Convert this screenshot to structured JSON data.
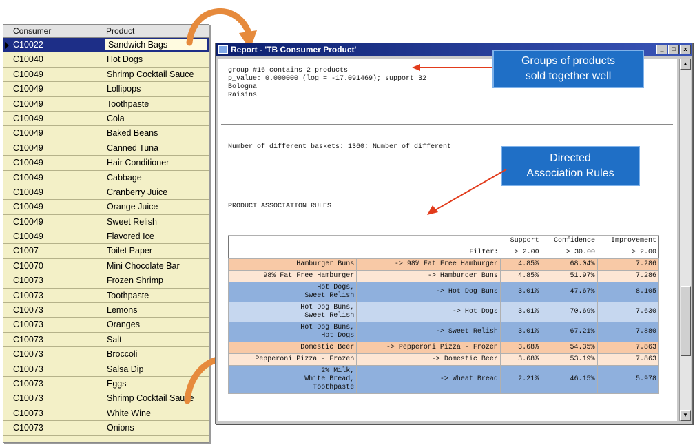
{
  "grid": {
    "columns": [
      "Consumer",
      "Product"
    ],
    "rows": [
      [
        "C10022",
        "Sandwich Bags"
      ],
      [
        "C10040",
        "Hot Dogs"
      ],
      [
        "C10049",
        "Shrimp Cocktail Sauce"
      ],
      [
        "C10049",
        "Lollipops"
      ],
      [
        "C10049",
        "Toothpaste"
      ],
      [
        "C10049",
        "Cola"
      ],
      [
        "C10049",
        "Baked Beans"
      ],
      [
        "C10049",
        "Canned Tuna"
      ],
      [
        "C10049",
        "Hair Conditioner"
      ],
      [
        "C10049",
        "Cabbage"
      ],
      [
        "C10049",
        "Cranberry Juice"
      ],
      [
        "C10049",
        "Orange Juice"
      ],
      [
        "C10049",
        "Sweet Relish"
      ],
      [
        "C10049",
        "Flavored Ice"
      ],
      [
        "C1007",
        "Toilet Paper"
      ],
      [
        "C10070",
        "Mini Chocolate Bar"
      ],
      [
        "C10073",
        "Frozen Shrimp"
      ],
      [
        "C10073",
        "Toothpaste"
      ],
      [
        "C10073",
        "Lemons"
      ],
      [
        "C10073",
        "Oranges"
      ],
      [
        "C10073",
        "Salt"
      ],
      [
        "C10073",
        "Broccoli"
      ],
      [
        "C10073",
        "Salsa Dip"
      ],
      [
        "C10073",
        "Eggs"
      ],
      [
        "C10073",
        "Shrimp Cocktail Sauce"
      ],
      [
        "C10073",
        "White Wine"
      ],
      [
        "C10073",
        "Onions"
      ]
    ],
    "selected_row": 0
  },
  "report": {
    "title": "Report - 'TB Consumer Product'",
    "window_buttons": [
      "_",
      "□",
      "x"
    ],
    "group_line1": "group #16 contains 2 products",
    "group_line2": "p_value: 0.000000 (log = -17.091469); support 32",
    "group_item1": "Bologna",
    "group_item2": "Raisins",
    "baskets_line": "Number of different baskets: 1360; Number of different",
    "rules_heading": "PRODUCT ASSOCIATION RULES",
    "table": {
      "headers": [
        "Support",
        "Confidence",
        "Improvement"
      ],
      "filter_label": "Filter:",
      "filters": [
        "> 2.00",
        "> 30.00",
        "> 2.00"
      ],
      "rows": [
        {
          "style": "peach",
          "lhs": "Hamburger Buns",
          "rhs": "-> 98% Fat Free Hamburger",
          "support": "4.85%",
          "confidence": "68.04%",
          "improvement": "7.286"
        },
        {
          "style": "lpeach",
          "lhs": "98% Fat Free Hamburger",
          "rhs": "-> Hamburger Buns",
          "support": "4.85%",
          "confidence": "51.97%",
          "improvement": "7.286"
        },
        {
          "style": "blue",
          "lhs": "Hot Dogs,\nSweet Relish",
          "rhs": "-> Hot Dog Buns",
          "support": "3.01%",
          "confidence": "47.67%",
          "improvement": "8.105"
        },
        {
          "style": "lblue",
          "lhs": "Hot Dog Buns,\nSweet Relish",
          "rhs": "-> Hot Dogs",
          "support": "3.01%",
          "confidence": "70.69%",
          "improvement": "7.630"
        },
        {
          "style": "blue",
          "lhs": "Hot Dog Buns,\nHot Dogs",
          "rhs": "-> Sweet Relish",
          "support": "3.01%",
          "confidence": "67.21%",
          "improvement": "7.880"
        },
        {
          "style": "peach",
          "lhs": "Domestic Beer",
          "rhs": "-> Pepperoni Pizza - Frozen",
          "support": "3.68%",
          "confidence": "54.35%",
          "improvement": "7.863"
        },
        {
          "style": "lpeach",
          "lhs": "Pepperoni Pizza - Frozen",
          "rhs": "-> Domestic Beer",
          "support": "3.68%",
          "confidence": "53.19%",
          "improvement": "7.863"
        },
        {
          "style": "blue",
          "lhs": "2% Milk,\nWhite Bread,\nToothpaste",
          "rhs": "-> Wheat Bread",
          "support": "2.21%",
          "confidence": "46.15%",
          "improvement": "5.978"
        }
      ]
    }
  },
  "callouts": {
    "groups": "Groups of products\nsold together well",
    "rules": "Directed\nAssociation Rules"
  },
  "colors": {
    "callout_blue": "#1f6fc6",
    "callout_arrow": "#e23b1b",
    "curved_arrow": "#e68a3c",
    "grid_bg": "#f3f0c7",
    "selection": "#1d2e87"
  }
}
